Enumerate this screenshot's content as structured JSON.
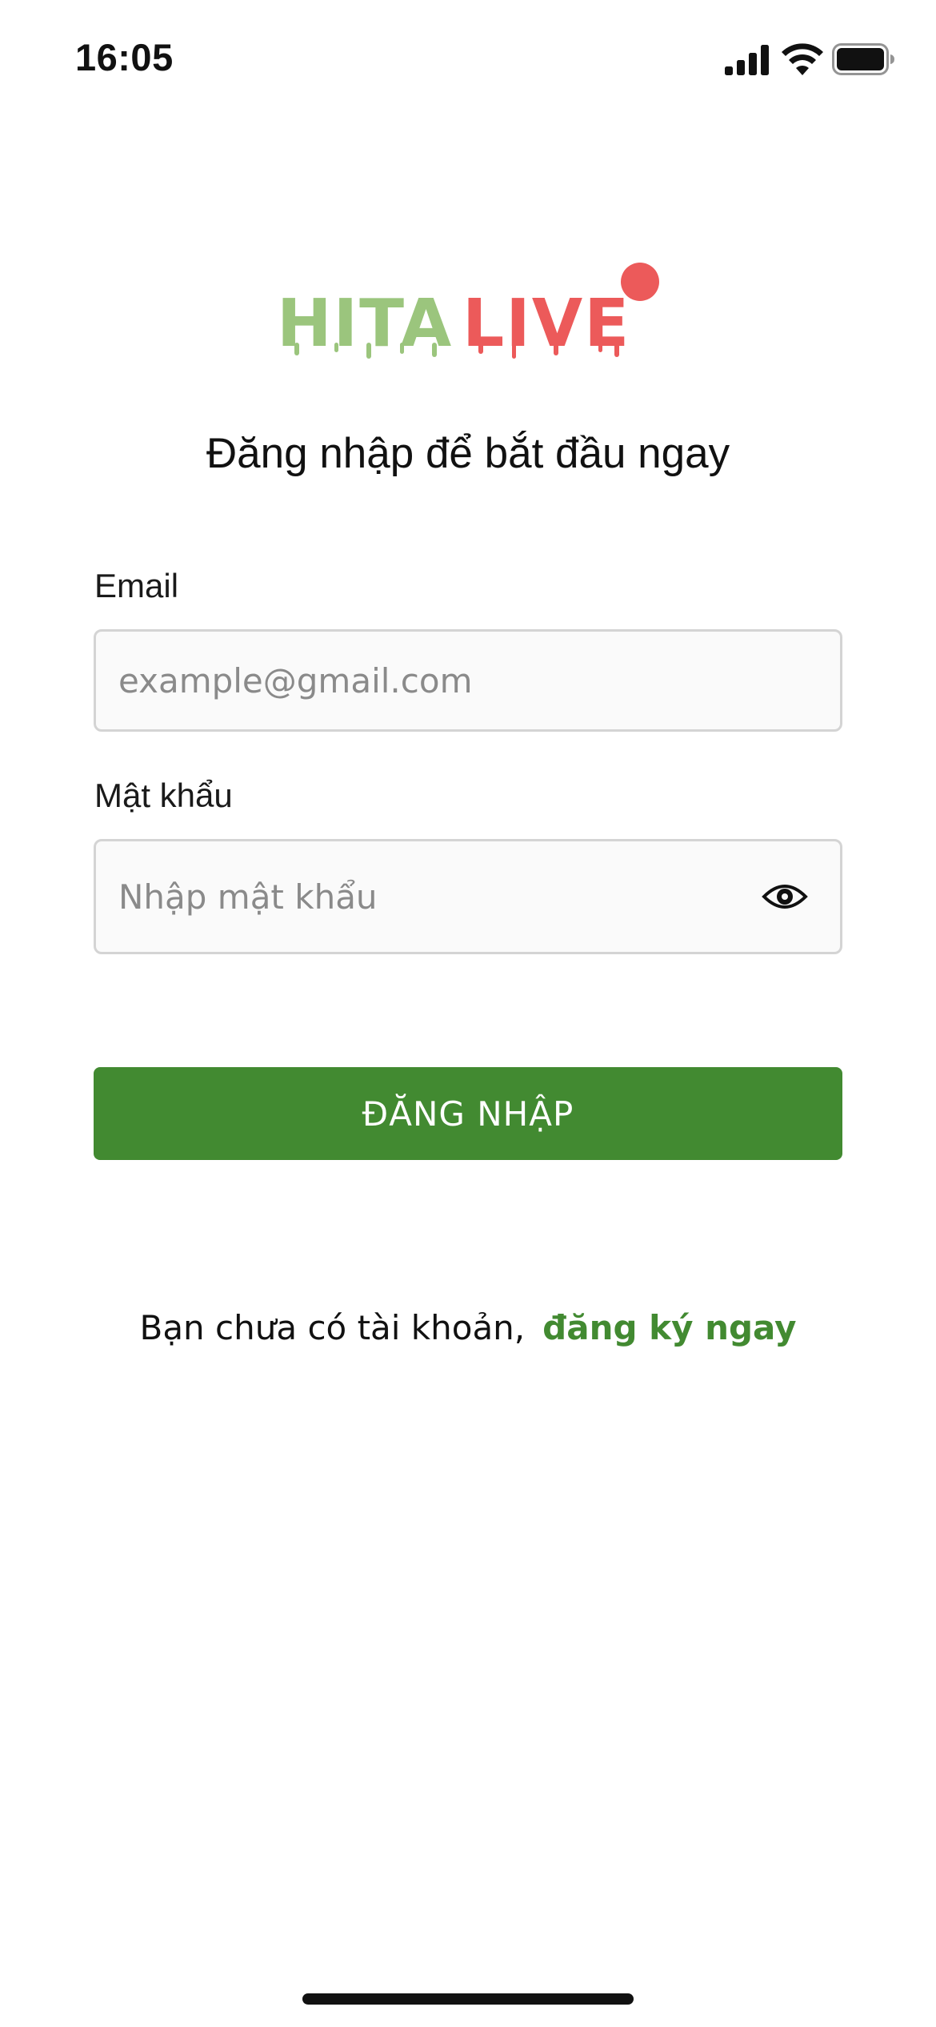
{
  "status_bar": {
    "time": "16:05",
    "icons": [
      "cellular-signal-icon",
      "wifi-icon",
      "battery-icon"
    ]
  },
  "logo": {
    "word1": "HITA",
    "word2": "LIVE",
    "colors": {
      "word1": "#9bc57d",
      "word2": "#ec5a5a"
    }
  },
  "login": {
    "title": "Đăng nhập để bắt đầu ngay",
    "email_label": "Email",
    "email_placeholder": "example@gmail.com",
    "email_value": "",
    "password_label": "Mật khẩu",
    "password_placeholder": "Nhập mật khẩu",
    "password_value": "",
    "password_toggle_icon": "eye-icon",
    "submit_label": "ĐĂNG NHẬP"
  },
  "signup": {
    "prompt": "Bạn chưa có tài khoản,",
    "link_label": "đăng ký ngay"
  },
  "colors": {
    "primary": "#428a31",
    "field_background": "#fafafa",
    "field_border": "#d4d4d4",
    "text": "#111111",
    "placeholder": "#8a8a8a"
  }
}
